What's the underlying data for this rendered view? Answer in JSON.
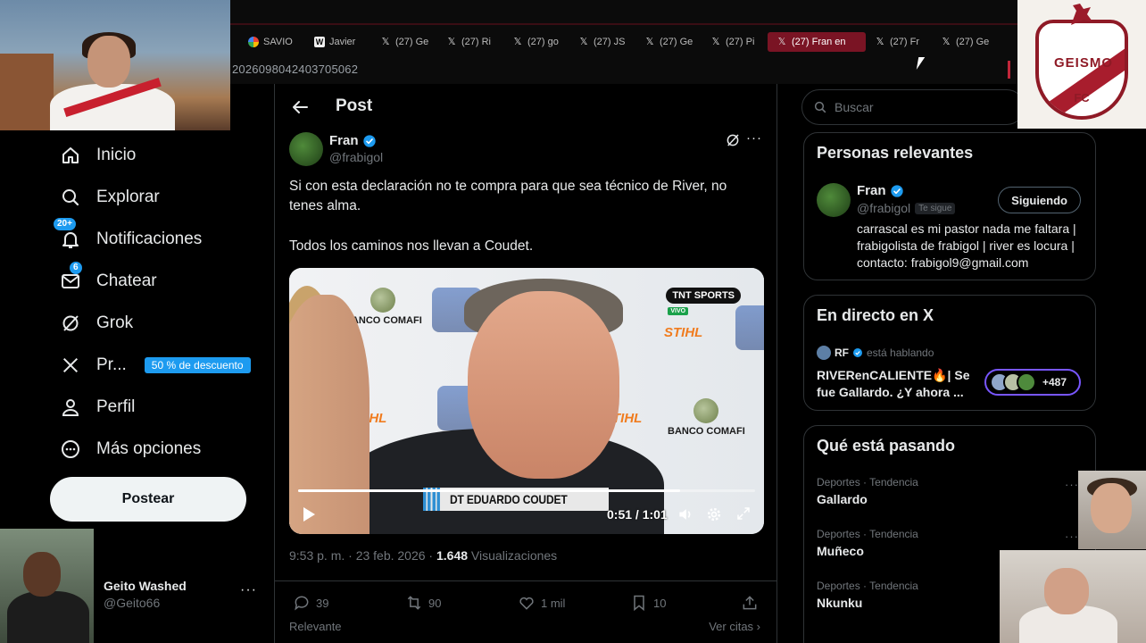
{
  "browser": {
    "tabs": [
      {
        "label": "SAVIO",
        "icon": "google-icon"
      },
      {
        "label": "Javier",
        "icon": "wikipedia-icon"
      },
      {
        "label": "(27) Ge",
        "icon": "x-logo-icon"
      },
      {
        "label": "(27) Ri",
        "icon": "x-logo-icon"
      },
      {
        "label": "(27) go",
        "icon": "x-logo-icon"
      },
      {
        "label": "(27) JS",
        "icon": "x-logo-icon"
      },
      {
        "label": "(27) Ge",
        "icon": "x-logo-icon"
      },
      {
        "label": "(27) Pi",
        "icon": "x-logo-icon"
      },
      {
        "label": "(27) Fran en",
        "icon": "x-logo-icon",
        "active": true
      },
      {
        "label": "(27) Fr",
        "icon": "x-logo-icon"
      },
      {
        "label": "(27) Ge",
        "icon": "x-logo-icon"
      }
    ],
    "url_fragment": "2026098042403705062"
  },
  "overlay": {
    "logo_name": "GEISMO",
    "logo_sub": "FC"
  },
  "nav": {
    "items": [
      {
        "label": "Inicio",
        "icon": "home-icon"
      },
      {
        "label": "Explorar",
        "icon": "search-icon"
      },
      {
        "label": "Notificaciones",
        "icon": "bell-icon",
        "badge": "20+"
      },
      {
        "label": "Chatear",
        "icon": "mail-icon",
        "badge": "6"
      },
      {
        "label": "Grok",
        "icon": "grok-icon"
      },
      {
        "label": "Pr...",
        "icon": "x-logo-icon",
        "promo": "50 % de descuento"
      },
      {
        "label": "Perfil",
        "icon": "person-icon"
      },
      {
        "label": "Más opciones",
        "icon": "more-circle-icon"
      }
    ],
    "post_button": "Postear",
    "account": {
      "name": "Geito Washed",
      "handle": "@Geito66"
    }
  },
  "post": {
    "header_title": "Post",
    "author": {
      "name": "Fran",
      "handle": "@frabigol"
    },
    "text_lines": [
      "Si con esta declaración no te compra para que sea técnico de River, no tenes alma.",
      "Todos los caminos nos llevan a Coudet."
    ],
    "video": {
      "caption": "DT EDUARDO COUDET",
      "channel": "TNT SPORTS",
      "live_tag": "VIVO",
      "sponsor_1": "BANCO COMAFI",
      "sponsor_2": "STIHL",
      "time": "0:51 / 1:01",
      "progress_fraction": 0.836
    },
    "meta": {
      "time": "9:53 p. m. · 23 feb. 2026 · ",
      "views": "1.648",
      "views_label": " Visualizaciones"
    },
    "actions": {
      "replies": "39",
      "reposts": "90",
      "likes": "1 mil",
      "bookmarks": "10"
    },
    "below_left": "Relevante",
    "below_right": "Ver citas ›"
  },
  "sidebar": {
    "search_placeholder": "Buscar",
    "relevant": {
      "title": "Personas relevantes",
      "name": "Fran",
      "handle": "@frabigol",
      "follows_you": "Te sigue",
      "button": "Siguiendo",
      "bio": "carrascal es mi pastor nada me faltara | frabigolista de frabigol | river es locura | contacto: frabigol9@gmail.com"
    },
    "live": {
      "title": "En directo en X",
      "host": "RF",
      "status": "está hablando",
      "space_title": "RIVERenCALIENTE🔥| Se fue Gallardo. ¿Y ahora ...",
      "listeners": "+487"
    },
    "trends": {
      "title": "Qué está pasando",
      "items": [
        {
          "category": "Deportes · Tendencia",
          "term": "Gallardo"
        },
        {
          "category": "Deportes · Tendencia",
          "term": "Muñeco"
        },
        {
          "category": "Deportes · Tendencia",
          "term": "Nkunku"
        }
      ]
    }
  },
  "colors": {
    "accent": "#1d9bf0",
    "active_tab": "#7a1424",
    "background": "#000000"
  }
}
